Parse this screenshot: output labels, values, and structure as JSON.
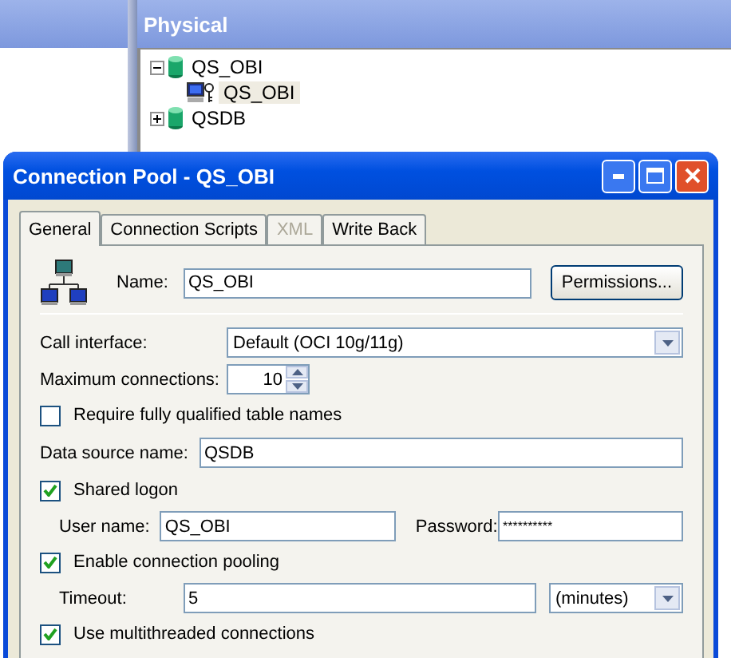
{
  "physical_panel": {
    "title": "Physical",
    "tree": [
      {
        "label": "QS_OBI",
        "kind": "database",
        "expanded": true,
        "selected": false,
        "children": [
          {
            "label": "QS_OBI",
            "kind": "connection_pool",
            "selected": true
          }
        ]
      },
      {
        "label": "QSDB",
        "kind": "database",
        "expanded": false,
        "selected": false
      }
    ]
  },
  "dialog": {
    "title": "Connection Pool - QS_OBI",
    "tabs": [
      {
        "label": "General",
        "selected": true,
        "disabled": false
      },
      {
        "label": "Connection Scripts",
        "selected": false,
        "disabled": false
      },
      {
        "label": "XML",
        "selected": false,
        "disabled": true
      },
      {
        "label": "Write Back",
        "selected": false,
        "disabled": false
      }
    ],
    "name": {
      "label": "Name:",
      "value": "QS_OBI"
    },
    "permissions_button": "Permissions...",
    "call_interface": {
      "label": "Call interface:",
      "value": "Default (OCI 10g/11g)"
    },
    "max_connections": {
      "label": "Maximum connections:",
      "value": "10"
    },
    "require_qualified": {
      "label": "Require fully qualified table names",
      "checked": false
    },
    "data_source": {
      "label": "Data source name:",
      "value": "QSDB"
    },
    "shared_logon": {
      "label": "Shared logon",
      "checked": true
    },
    "user_name": {
      "label": "User name:",
      "value": "QS_OBI"
    },
    "password": {
      "label": "Password:",
      "value": "**********"
    },
    "pooling": {
      "label": "Enable connection pooling",
      "checked": true
    },
    "timeout": {
      "label": "Timeout:",
      "value": "5",
      "unit": "(minutes)"
    },
    "multithreaded": {
      "label": "Use multithreaded connections",
      "checked": true
    }
  }
}
